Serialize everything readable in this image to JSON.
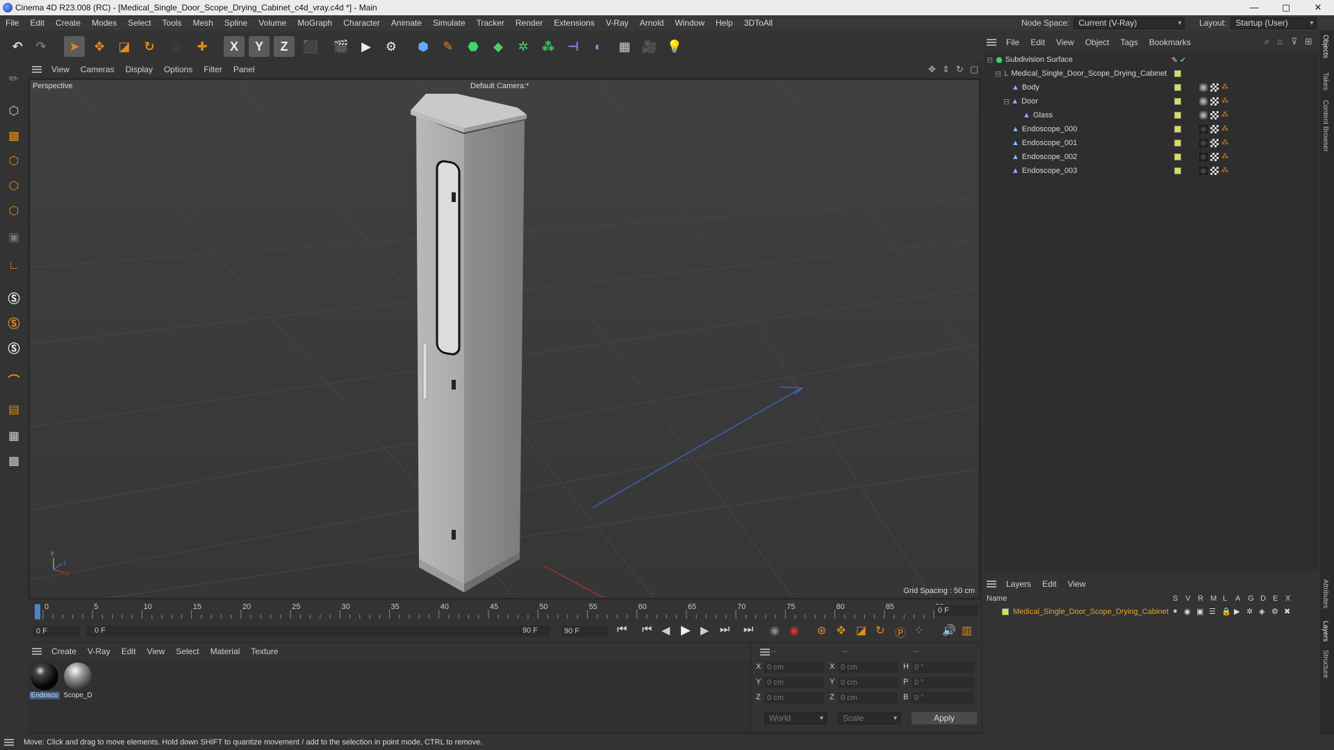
{
  "window": {
    "title": "Cinema 4D R23.008 (RC) - [Medical_Single_Door_Scope_Drying_Cabinet_c4d_vray.c4d *] - Main",
    "minimize": "—",
    "maximize": "▢",
    "close": "✕"
  },
  "menu": {
    "items": [
      "File",
      "Edit",
      "Create",
      "Modes",
      "Select",
      "Tools",
      "Mesh",
      "Spline",
      "Volume",
      "MoGraph",
      "Character",
      "Animate",
      "Simulate",
      "Tracker",
      "Render",
      "Extensions",
      "V-Ray",
      "Arnold",
      "Window",
      "Help",
      "3DToAll"
    ],
    "node_space_label": "Node Space:",
    "node_space_value": "Current (V-Ray)",
    "layout_label": "Layout:",
    "layout_value": "Startup (User)"
  },
  "toolbar": {
    "icons": [
      "undo-icon",
      "redo-icon",
      "select-icon",
      "move-icon",
      "scale-icon",
      "rotate-icon",
      "live-select-icon",
      "add-icon",
      "x-axis-icon",
      "y-axis-icon",
      "z-axis-icon",
      "coord-system-icon",
      "render-view-icon",
      "render-icon",
      "render-settings-icon",
      "cube-icon",
      "pen-icon",
      "subdivision-icon",
      "extrude-icon",
      "cloner-icon",
      "instance-icon",
      "deformer-icon",
      "field-icon",
      "floor-icon",
      "camera-icon",
      "light-icon"
    ],
    "axis_x": "X",
    "axis_y": "Y",
    "axis_z": "Z"
  },
  "viewport": {
    "menu": [
      "View",
      "Cameras",
      "Display",
      "Options",
      "Filter",
      "Panel"
    ],
    "view_name": "Perspective",
    "camera": "Default Camera",
    "grid_spacing": "Grid Spacing : 50 cm"
  },
  "timeline": {
    "ticks": [
      "0",
      "5",
      "10",
      "15",
      "20",
      "25",
      "30",
      "35",
      "40",
      "45",
      "50",
      "55",
      "60",
      "65",
      "70",
      "75",
      "80",
      "85",
      "90"
    ],
    "current_frame": "0 F",
    "start_frame": "0 F",
    "range_start": "0 F",
    "range_end": "90 F",
    "end_frame": "90 F"
  },
  "materials": {
    "menu": [
      "Create",
      "V-Ray",
      "Edit",
      "View",
      "Select",
      "Material",
      "Texture"
    ],
    "items": [
      {
        "name": "Endosco"
      },
      {
        "name": "Scope_D"
      }
    ]
  },
  "coords": {
    "header": [
      "--",
      "--",
      "--"
    ],
    "rows": [
      {
        "a": "X",
        "av": "0 cm",
        "b": "X",
        "bv": "0 cm",
        "c": "H",
        "cv": "0 °"
      },
      {
        "a": "Y",
        "av": "0 cm",
        "b": "Y",
        "bv": "0 cm",
        "c": "P",
        "cv": "0 °"
      },
      {
        "a": "Z",
        "av": "0 cm",
        "b": "Z",
        "bv": "0 cm",
        "c": "B",
        "cv": "0 °"
      }
    ],
    "space": "World",
    "mode": "Scale",
    "apply": "Apply"
  },
  "objects": {
    "menu": [
      "File",
      "Edit",
      "View",
      "Object",
      "Tags",
      "Bookmarks"
    ],
    "rows": [
      {
        "name": "Subdivision Surface",
        "indent": 0
      },
      {
        "name": "Medical_Single_Door_Scope_Drying_Cabinet",
        "indent": 1
      },
      {
        "name": "Body",
        "indent": 2
      },
      {
        "name": "Door",
        "indent": 2
      },
      {
        "name": "Glass",
        "indent": 3
      },
      {
        "name": "Endoscope_000",
        "indent": 2
      },
      {
        "name": "Endoscope_001",
        "indent": 2
      },
      {
        "name": "Endoscope_002",
        "indent": 2
      },
      {
        "name": "Endoscope_003",
        "indent": 2
      }
    ]
  },
  "layers": {
    "menu": [
      "Layers",
      "Edit",
      "View"
    ],
    "header_name": "Name",
    "header_cols": [
      "S",
      "V",
      "R",
      "M",
      "L",
      "A",
      "G",
      "D",
      "E",
      "X"
    ],
    "row_name": "Medical_Single_Door_Scope_Drying_Cabinet",
    "accent": "#e8a12a"
  },
  "side_tabs": [
    "Objects",
    "Takes",
    "Content Browser",
    "Attributes",
    "Layers",
    "Structure"
  ],
  "status": "Move: Click and drag to move elements. Hold down SHIFT to quantize movement / add to the selection in point mode, CTRL to remove."
}
